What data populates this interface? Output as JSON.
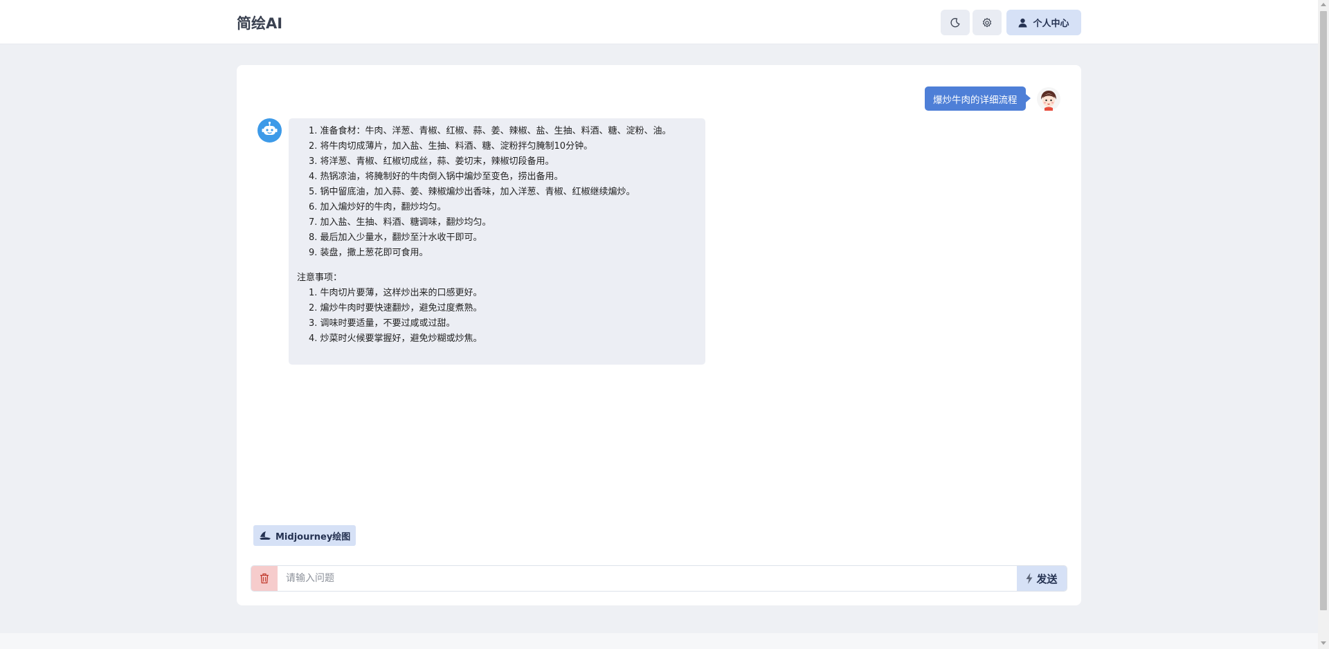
{
  "header": {
    "brand": "简绘AI",
    "theme_icon": "moon-icon",
    "settings_icon": "gear-icon",
    "user_center_label": "个人中心"
  },
  "chat": {
    "user_message": "爆炒牛肉的详细流程",
    "bot_steps": [
      "1. 准备食材：牛肉、洋葱、青椒、红椒、蒜、姜、辣椒、盐、生抽、料酒、糖、淀粉、油。",
      "2. 将牛肉切成薄片，加入盐、生抽、料酒、糖、淀粉拌匀腌制10分钟。",
      "3. 将洋葱、青椒、红椒切成丝，蒜、姜切末，辣椒切段备用。",
      "4. 热锅凉油，将腌制好的牛肉倒入锅中煸炒至变色，捞出备用。",
      "5. 锅中留底油，加入蒜、姜、辣椒煸炒出香味，加入洋葱、青椒、红椒继续煸炒。",
      "6. 加入煸炒好的牛肉，翻炒均匀。",
      "7. 加入盐、生抽、料酒、糖调味，翻炒均匀。",
      "8. 最后加入少量水，翻炒至汁水收干即可。",
      "9. 装盘，撒上葱花即可食用。"
    ],
    "notes_title": "注意事项：",
    "notes": [
      "1. 牛肉切片要薄，这样炒出来的口感更好。",
      "2. 煸炒牛肉时要快速翻炒，避免过度煮熟。",
      "3. 调味时要适量，不要过咸或过甜。",
      "4. 炒菜时火候要掌握好，避免炒糊或炒焦。"
    ]
  },
  "mode": {
    "label": "Midjourney绘图"
  },
  "composer": {
    "placeholder": "请输入问题",
    "send_label": "发送"
  },
  "colors": {
    "accent": "#4e7fd7",
    "button_bg": "#d6e1f6",
    "danger_bg": "#f6cccc"
  }
}
